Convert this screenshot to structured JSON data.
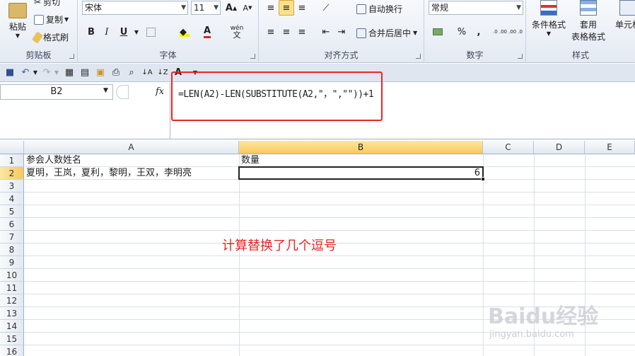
{
  "ribbon": {
    "clipboard": {
      "label": "剪贴板",
      "paste": "粘贴",
      "cut": "剪切",
      "copy": "复制",
      "format_painter": "格式刷"
    },
    "font": {
      "label": "字体",
      "font_name": "宋体",
      "font_size": "11",
      "bold": "B",
      "italic": "I",
      "underline": "U",
      "grow": "A",
      "shrink": "A",
      "wen": "wén"
    },
    "alignment": {
      "label": "对齐方式",
      "wrap_text": "自动换行",
      "merge_center": "合并后居中"
    },
    "number": {
      "label": "数字",
      "format": "常规",
      "percent": "%",
      "comma": ",",
      "inc_decimal": ".0 .00",
      "dec_decimal": ".00 .0"
    },
    "styles": {
      "label": "样式",
      "conditional": "条件格式",
      "table_format_1": "套用",
      "table_format_2": "表格格式",
      "cell_styles": "单元格"
    }
  },
  "formula_bar": {
    "name_box": "B2",
    "fx": "fx",
    "formula": "=LEN(A2)-LEN(SUBSTITUTE(A2,\"，\",\"\"))+1"
  },
  "grid": {
    "columns": [
      "A",
      "B",
      "C",
      "D",
      "E"
    ],
    "rows": [
      "1",
      "2",
      "3",
      "4",
      "5",
      "6",
      "7",
      "8",
      "9",
      "10",
      "11",
      "12",
      "13",
      "14",
      "15",
      "16"
    ],
    "cells": {
      "A1": "参会人数姓名",
      "B1": "数量",
      "A2": "夏明，王岚，夏利，黎明，王双，李明亮",
      "B2": "6"
    }
  },
  "annotation": "计算替换了几个逗号",
  "watermark": {
    "main": "Baidu经验",
    "sub": "jingyan.baidu.com"
  },
  "colors": {
    "accent_red": "#e82626",
    "selected_header": "#f7c95d"
  }
}
